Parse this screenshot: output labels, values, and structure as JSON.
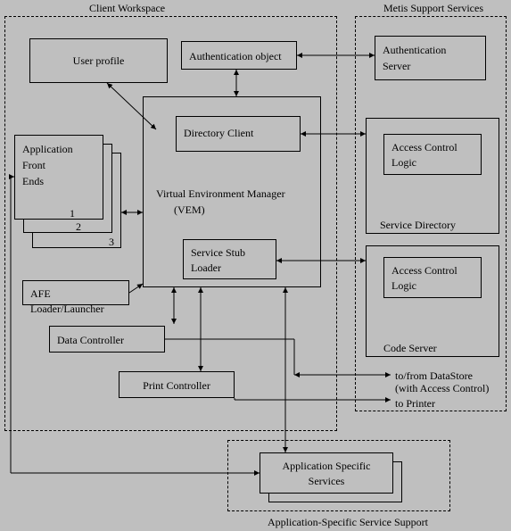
{
  "titles": {
    "client_workspace": "Client Workspace",
    "metis_services": "Metis Support Services",
    "app_specific_support": "Application-Specific Service Support"
  },
  "client": {
    "user_profile": "User profile",
    "auth_object": "Authentication object",
    "afe_label_l1": "Application",
    "afe_label_l2": "Front",
    "afe_label_l3": "Ends",
    "stack1": "1",
    "stack2": "2",
    "stack3": "3",
    "vem_l1": "Virtual Environment Manager",
    "vem_l2": "(VEM)",
    "directory_client": "Directory  Client",
    "service_stub_l1": "Service Stub",
    "service_stub_l2": "Loader",
    "afe_loader": "AFE Loader/Launcher",
    "data_controller": "Data Controller",
    "print_controller": "Print Controller"
  },
  "metis": {
    "auth_server_l1": "Authentication",
    "auth_server_l2": "Server",
    "acl_l1": "Access Control",
    "acl_l2": "Logic",
    "service_directory": "Service Directory",
    "code_server": "Code Server"
  },
  "app_services": {
    "l1": "Application Specific",
    "l2": "Services"
  },
  "annotations": {
    "datastore_l1": "to/from DataStore",
    "datastore_l2": "(with Access Control)",
    "printer": "to Printer"
  }
}
